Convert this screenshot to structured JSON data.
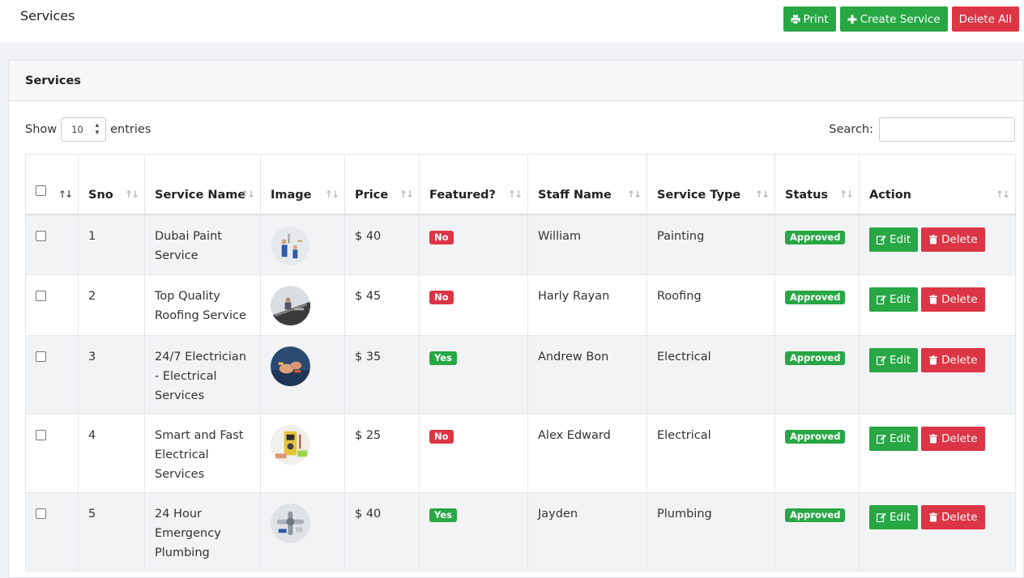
{
  "header": {
    "title": "Services",
    "print_label": "Print",
    "create_label": "Create Service",
    "delete_all_label": "Delete All"
  },
  "card": {
    "title": "Services",
    "show_label": "Show",
    "entries_value": "10",
    "entries_label": "entries",
    "search_label": "Search:",
    "search_value": ""
  },
  "table": {
    "columns": [
      "Sno",
      "Service Name",
      "Image",
      "Price",
      "Featured?",
      "Staff Name",
      "Service Type",
      "Status",
      "Action"
    ],
    "edit_label": "Edit",
    "delete_label": "Delete",
    "rows": [
      {
        "sno": "1",
        "name": "Dubai Paint Service",
        "image": "painting-thumbnail",
        "price": "$ 40",
        "featured": "No",
        "staff": "William",
        "type": "Painting",
        "status": "Approved"
      },
      {
        "sno": "2",
        "name": "Top Quality Roofing Service",
        "image": "roofing-thumbnail",
        "price": "$ 45",
        "featured": "No",
        "staff": "Harly Rayan",
        "type": "Roofing",
        "status": "Approved"
      },
      {
        "sno": "3",
        "name": "24/7 Electrician - Electrical Services",
        "image": "electrician-thumbnail",
        "price": "$ 35",
        "featured": "Yes",
        "staff": "Andrew Bon",
        "type": "Electrical",
        "status": "Approved"
      },
      {
        "sno": "4",
        "name": "Smart and Fast Electrical Services",
        "image": "electrical-thumbnail",
        "price": "$ 25",
        "featured": "No",
        "staff": "Alex Edward",
        "type": "Electrical",
        "status": "Approved"
      },
      {
        "sno": "5",
        "name": "24 Hour Emergency Plumbing",
        "image": "plumbing-thumbnail",
        "price": "$ 40",
        "featured": "Yes",
        "staff": "Jayden",
        "type": "Plumbing",
        "status": "Approved"
      }
    ]
  },
  "colors": {
    "green": "#28a745",
    "red": "#dc3545"
  }
}
